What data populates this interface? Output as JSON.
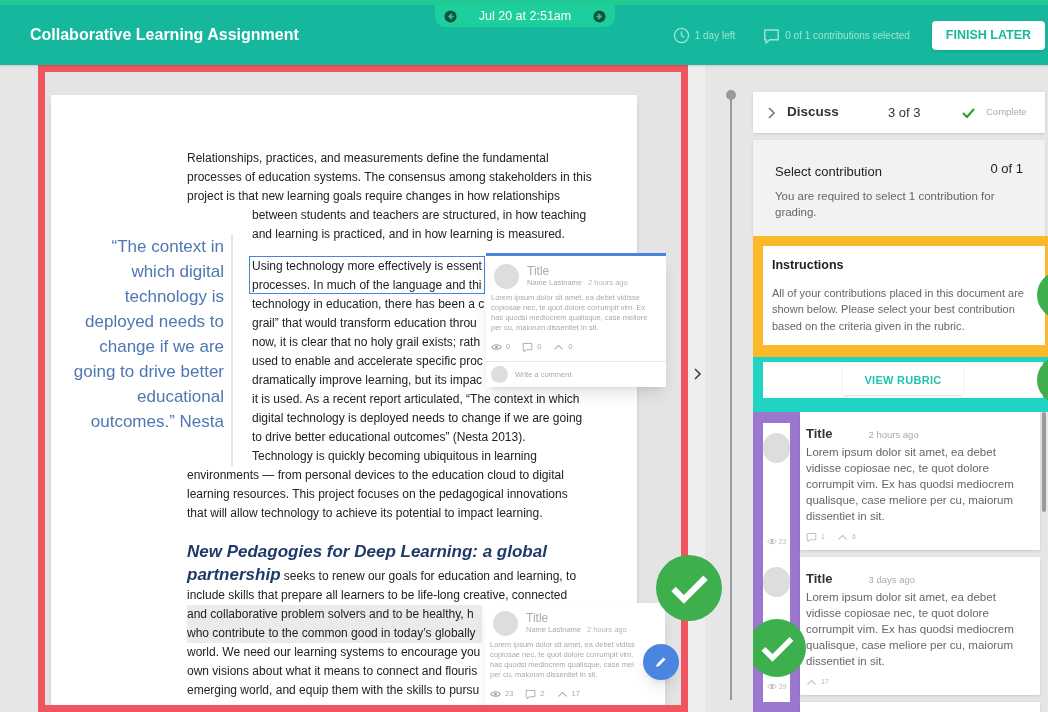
{
  "header": {
    "title": "Collaborative Learning Assignment",
    "date": "Jul 20 at 2:51am",
    "time_left": "1 day left",
    "contributions": "0 of 1 contributions selected",
    "finish_button": "FINISH LATER"
  },
  "document": {
    "intro": [
      "Relationships, practices, and measurements define the fundamental",
      "processes of education systems. The consensus among stakeholders in this",
      "project is that new learning goals require changes in how relationships"
    ],
    "quote": [
      "“The context in",
      "which digital",
      "technology is",
      "deployed needs to",
      "change if we are",
      "going to drive better",
      "educational",
      "outcomes.” Nesta"
    ],
    "beside_paragraphs": [
      [
        "between students and teachers are structured, in how teaching",
        "and learning is practiced, and in how learning is measured."
      ],
      [
        "Using technology more effectively is essent",
        "processes. In much of the language and thi",
        "technology in education, there has been a c",
        "grail” that would transform education throu",
        "now, it is clear that no holy grail exists; rath",
        "used to enable and accelerate specific proc",
        "dramatically improve learning, but its impac",
        "it is used. As a recent report articulated, “The context in which",
        "digital technology is deployed needs to change if we are going",
        "to drive better educational outcomes” (Nesta 2013).",
        "Technology is quickly becoming ubiquitous in learning"
      ]
    ],
    "after": [
      "environments — from personal devices to the education cloud to digital",
      "learning resources. This project focuses on the pedagogical innovations",
      "that will allow technology to achieve its potential to impact learning."
    ],
    "heading": [
      "New Pedagogies for Deep Learning: a global",
      "partnership"
    ],
    "heading_text": [
      {
        "text": " seeks to renew our goals for education and learning, to",
        "highlighted": false
      },
      {
        "text": "include skills that prepare all learners to be life-long creative, connected",
        "highlighted": false
      },
      {
        "text": "and collaborative problem solvers and to be healthy, h",
        "highlighted": true
      },
      {
        "text": "who contribute to the common good in today’s globally",
        "highlighted": true
      },
      {
        "text": "world. We need our learning systems to encourage you",
        "highlighted": false
      },
      {
        "text": "own visions about what it means to connect and flouris",
        "highlighted": false
      },
      {
        "text": "emerging world, and equip them with the skills to pursu",
        "highlighted": false
      }
    ],
    "popup": {
      "title": "Title",
      "author": "Name Lastname",
      "time": "2 hours ago",
      "body": [
        "Lorem ipsum dolor sit amet, ea debet vidisse",
        "copiosae nec, te quot dolore corrumpit vim. Ex",
        "has quodsi mediocrem qualisque, case meliore",
        "per cu, maiorum dissentiet in sit."
      ],
      "views": "0",
      "comments": "0",
      "likes": "0",
      "comment_placeholder": "Write a comment"
    },
    "bottom_card": {
      "title": "Title",
      "author": "Name Lastname",
      "time": "2 hours ago",
      "body": [
        "Lorem ipsum dolor sit amet, ea debet vidiss",
        "copiosae nec, te quot dolore corrumpit vim.",
        "has quodsi mediocrem qualisque, case mel",
        "per cu, maiorum dissentiet in sit."
      ],
      "views": "23",
      "comments": "2",
      "likes": "17",
      "selected": true
    }
  },
  "side_panel": {
    "step": {
      "label": "Discuss",
      "progress": "3 of 3",
      "status": "Complete",
      "complete": true
    },
    "select": {
      "title": "Select contribution",
      "count": "0 of 1",
      "description": "You are required to select 1 contribution for grading."
    },
    "instructions": {
      "title": "Instructions",
      "text": "All of your contributions placed in this document are shown below. Please select your best contribution based on the criteria given in the rubric."
    },
    "rubric_button": "VIEW RUBRIC",
    "contributions": [
      {
        "title": "Title",
        "time": "2 hours ago",
        "body": "Lorem ipsum dolor sit amet, ea debet vidisse copiosae nec, te quot dolore corrumpit vim. Ex has quodsi mediocrem qualisque, case meliore per cu, maiorum dissentiet in sit.",
        "views": "23",
        "comments": "1",
        "likes": "6",
        "selected": false
      },
      {
        "title": "Title",
        "time": "3 days ago",
        "body": "Lorem ipsum dolor sit amet, ea debet vidisse copiosae nec, te quot dolore corrumpit vim. Ex has quodsi mediocrem qualisque, case meliore per cu, maiorum dissentiet in sit.",
        "views": "39",
        "likes": "17",
        "selected": true
      }
    ]
  }
}
